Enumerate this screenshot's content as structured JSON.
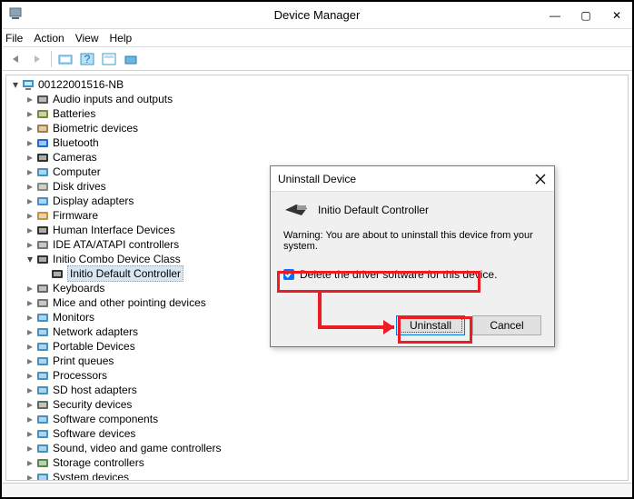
{
  "window": {
    "title": "Device Manager",
    "controls": {
      "min": "—",
      "max": "▢",
      "close": "✕"
    }
  },
  "menu": {
    "file": "File",
    "action": "Action",
    "view": "View",
    "help": "Help"
  },
  "tree": {
    "root": "00122001516-NB",
    "nodes": [
      {
        "label": "Audio inputs and outputs"
      },
      {
        "label": "Batteries"
      },
      {
        "label": "Biometric devices"
      },
      {
        "label": "Bluetooth"
      },
      {
        "label": "Cameras"
      },
      {
        "label": "Computer"
      },
      {
        "label": "Disk drives"
      },
      {
        "label": "Display adapters"
      },
      {
        "label": "Firmware"
      },
      {
        "label": "Human Interface Devices"
      },
      {
        "label": "IDE ATA/ATAPI controllers"
      },
      {
        "label": "Initio Combo Device Class",
        "expanded": true,
        "children": [
          {
            "label": "Initio Default Controller",
            "selected": true
          }
        ]
      },
      {
        "label": "Keyboards"
      },
      {
        "label": "Mice and other pointing devices"
      },
      {
        "label": "Monitors"
      },
      {
        "label": "Network adapters"
      },
      {
        "label": "Portable Devices"
      },
      {
        "label": "Print queues"
      },
      {
        "label": "Processors"
      },
      {
        "label": "SD host adapters"
      },
      {
        "label": "Security devices"
      },
      {
        "label": "Software components"
      },
      {
        "label": "Software devices"
      },
      {
        "label": "Sound, video and game controllers"
      },
      {
        "label": "Storage controllers"
      },
      {
        "label": "System devices"
      }
    ]
  },
  "dialog": {
    "title": "Uninstall Device",
    "device": "Initio Default Controller",
    "warning": "Warning: You are about to uninstall this device from your system.",
    "checkbox": "Delete the driver software for this device.",
    "uninstall": "Uninstall",
    "cancel": "Cancel"
  }
}
